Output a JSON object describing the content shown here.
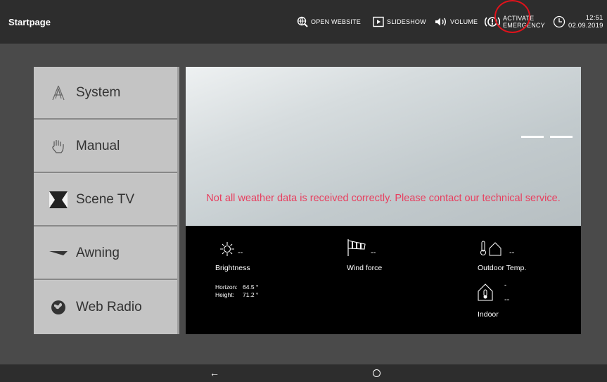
{
  "topbar": {
    "title": "Startpage",
    "open_website": "OPEN WEBSITE",
    "slideshow": "SLIDESHOW",
    "volume": "VOLUME",
    "emergency_line1": "ACTIVATE",
    "emergency_line2": "EMERGENCY",
    "time": "12:51",
    "date": "02.09.2019"
  },
  "menu": {
    "items": [
      {
        "label": "System",
        "icon": "system-a-icon"
      },
      {
        "label": "Manual",
        "icon": "hand-icon"
      },
      {
        "label": "Scene TV",
        "icon": "scene-tv-icon"
      },
      {
        "label": "Awning",
        "icon": "awning-icon"
      },
      {
        "label": "Web Radio",
        "icon": "globe-icon"
      }
    ]
  },
  "weather": {
    "error_message": "Not all weather data is received correctly. Please contact our technical service.",
    "brightness": {
      "label": "Brightness",
      "value": "--"
    },
    "wind": {
      "label": "Wind force",
      "value": "--"
    },
    "outdoor": {
      "label": "Outdoor Temp.",
      "value": "--"
    },
    "indoor": {
      "label": "Indoor",
      "value1": "-",
      "value2": "--"
    },
    "horizon_label": "Horizon:",
    "horizon_value": "64.5 °",
    "height_label": "Height:",
    "height_value": "71.2 °"
  },
  "colors": {
    "error": "#e83e5e",
    "highlight": "#e0121b"
  }
}
